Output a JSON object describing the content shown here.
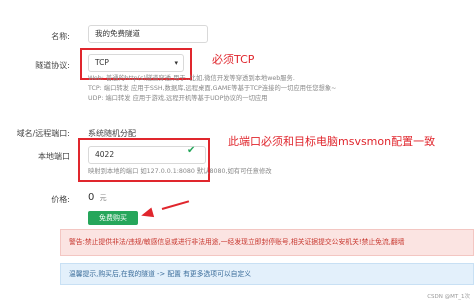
{
  "form": {
    "name": {
      "label": "名称:",
      "value": "我的免费隧道"
    },
    "protocol": {
      "label": "隧道协议:",
      "selected": "TCP"
    },
    "protocol_notes": [
      "Web: 普通的http(s)隧道穿透,用于..比如,微信开发等穿透到本地web服务.",
      "TCP: 端口转发 应用于SSH,数据库,远程桌面,GAME等基于TCP连接的一切应用任您想象~",
      "UDP: 端口转发 应用于游戏,远程开机等基于UDP协议的一切应用"
    ],
    "domain": {
      "label": "域名/远程端口:",
      "value": "系统随机分配"
    },
    "local_port": {
      "label": "本地端口",
      "value": "4022",
      "hint": "映射到本地的端口 如127.0.0.1:8080 默认8080,如有可任意修改"
    },
    "price": {
      "label": "价格:",
      "value": "0",
      "unit": "元"
    },
    "buy_button": "免费购买"
  },
  "annotations": {
    "protocol": "必须TCP",
    "port": "此端口必须和目标电脑msvsmon配置一致"
  },
  "alerts": {
    "warning": "警告:禁止提供非法/违规/敏感信息或进行非法用途,一经发现立即封停账号,相关证据提交公安机关!禁止免流,翻墙",
    "tip": "温馨提示,购买后,在我的隧道 -> 配置 有更多选项可以自定义"
  },
  "watermark": "CSDN @MT_1次",
  "colors": {
    "accent": "#e0262d",
    "button": "#26a65b"
  }
}
